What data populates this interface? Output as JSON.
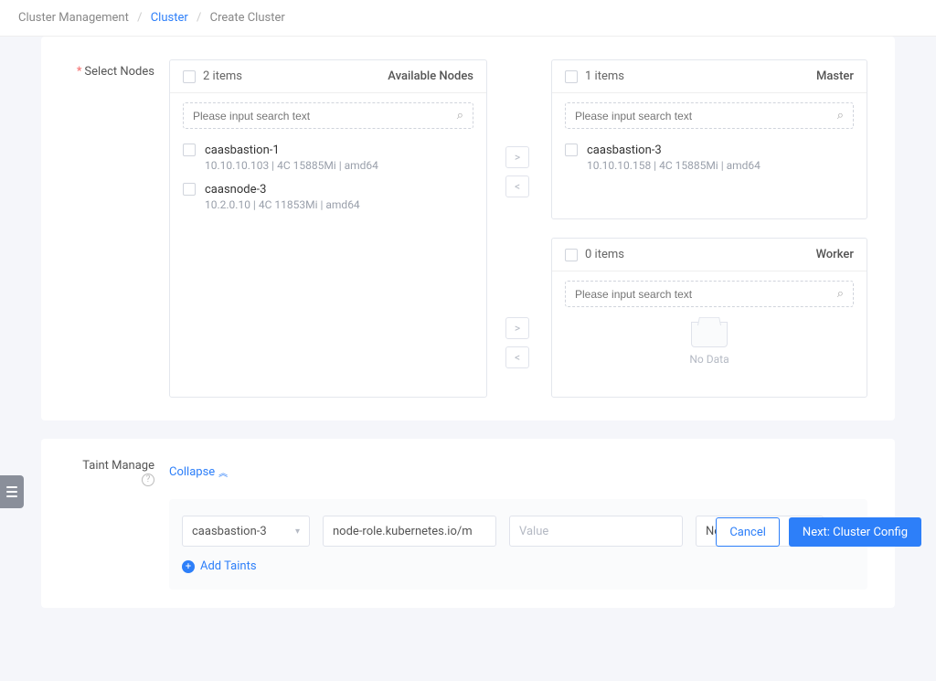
{
  "breadcrumb": {
    "root": "Cluster Management",
    "link": "Cluster",
    "current": "Create Cluster"
  },
  "selectNodes": {
    "label": "Select Nodes",
    "available": {
      "count_label": "2 items",
      "role": "Available Nodes",
      "search_placeholder": "Please input search text",
      "items": [
        {
          "name": "caasbastion-1",
          "meta": "10.10.10.103 | 4C 15885Mi | amd64"
        },
        {
          "name": "caasnode-3",
          "meta": "10.2.0.10 | 4C 11853Mi | amd64"
        }
      ]
    },
    "master": {
      "count_label": "1 items",
      "role": "Master",
      "search_placeholder": "Please input search text",
      "items": [
        {
          "name": "caasbastion-3",
          "meta": "10.10.10.158 | 4C 15885Mi | amd64"
        }
      ]
    },
    "worker": {
      "count_label": "0 items",
      "role": "Worker",
      "search_placeholder": "Please input search text",
      "empty_text": "No Data"
    },
    "transfer": {
      "right": ">",
      "left": "<"
    }
  },
  "taint": {
    "label": "Taint Manage",
    "collapse": "Collapse",
    "row": {
      "node": "caasbastion-3",
      "key": "node-role.kubernetes.io/m",
      "value_placeholder": "Value",
      "effect": "NoSchedule"
    },
    "add": "Add Taints"
  },
  "footer": {
    "cancel": "Cancel",
    "next": "Next: Cluster Config"
  }
}
